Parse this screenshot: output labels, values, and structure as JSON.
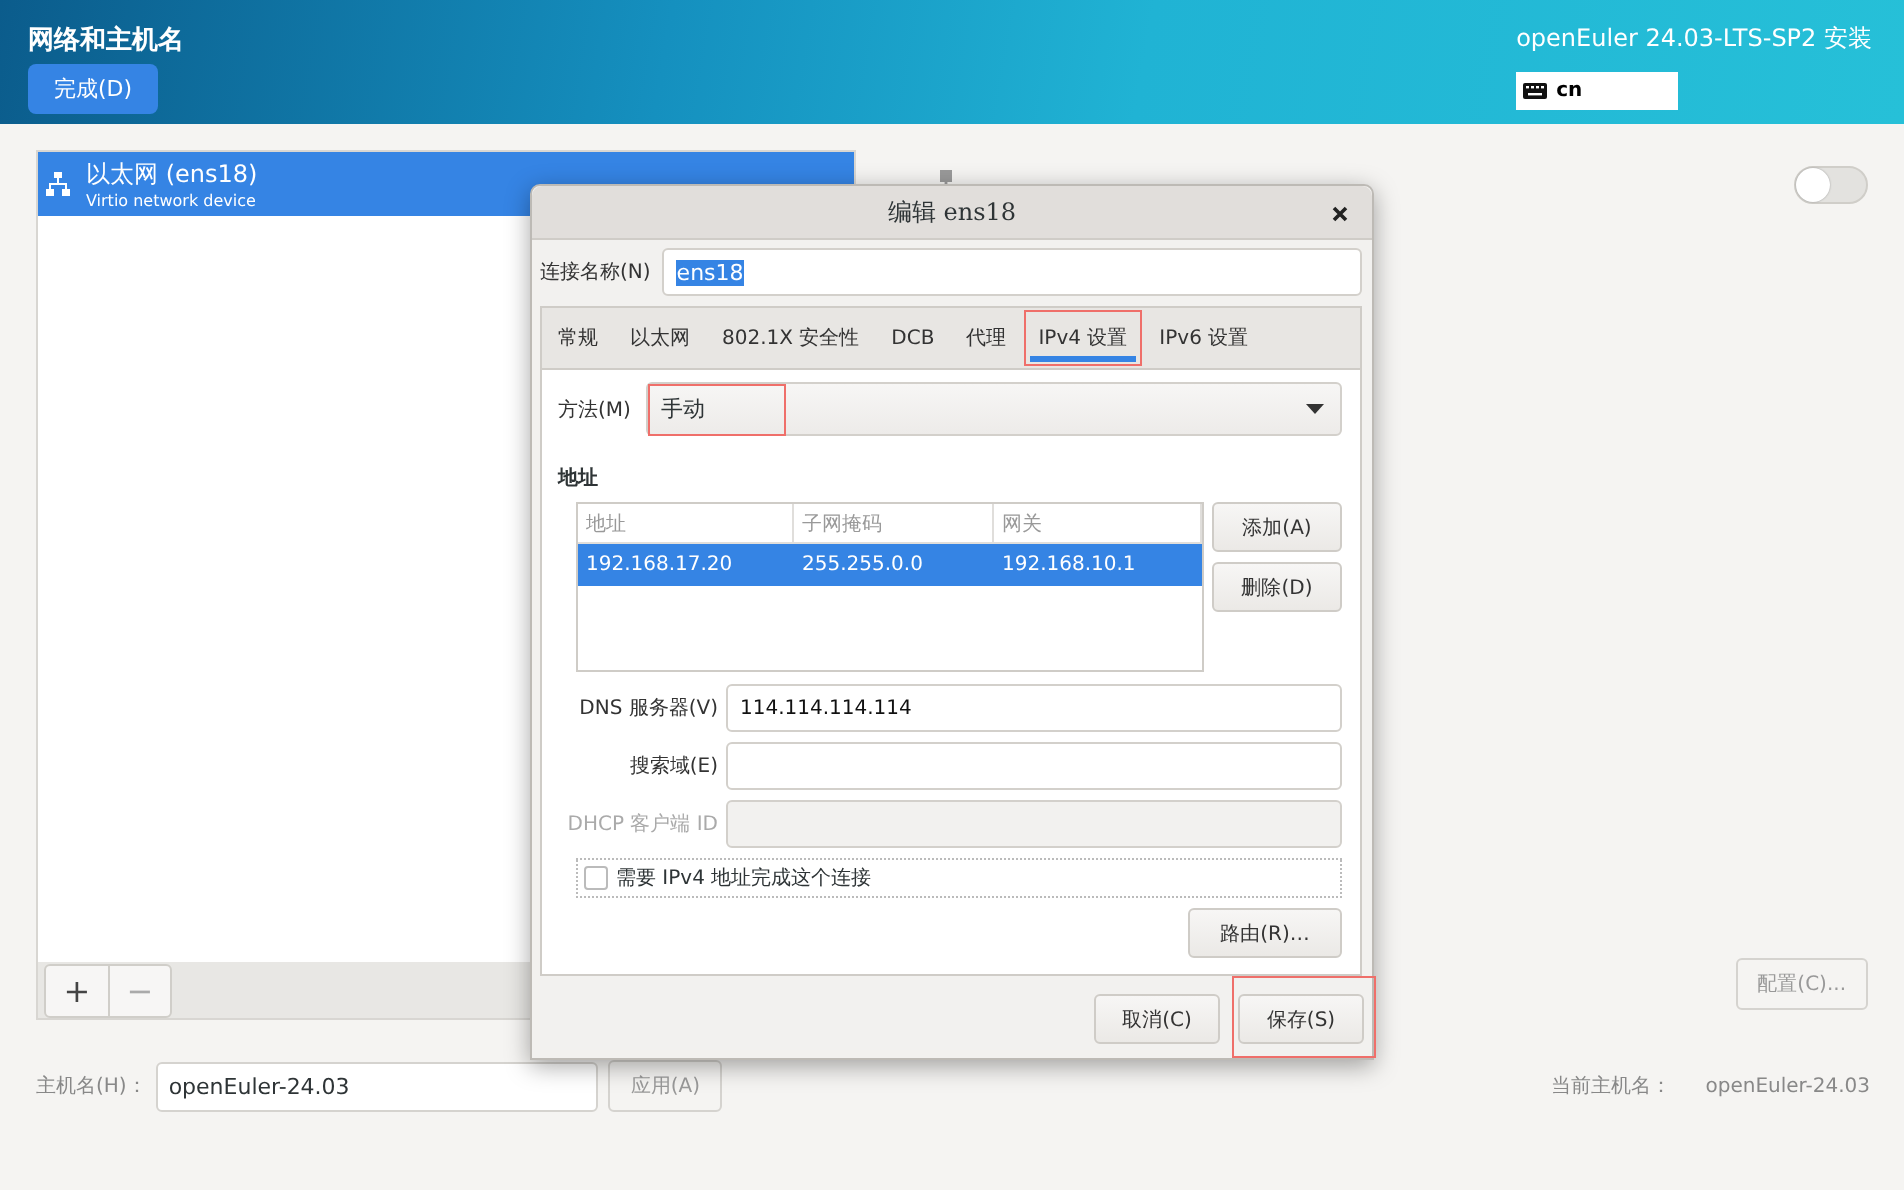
{
  "header": {
    "title": "网络和主机名",
    "done_button": "完成(D)",
    "product": "openEuler 24.03-LTS-SP2 安装",
    "keyboard_layout": "cn"
  },
  "devices": [
    {
      "name": "以太网 (ens18)",
      "description": "Virtio network device",
      "selected": true
    }
  ],
  "device_toolbar": {
    "add": "+",
    "remove": "−"
  },
  "device_switch": {
    "on": false
  },
  "configure_button": "配置(C)...",
  "hostname": {
    "label": "主机名(H)：",
    "value": "openEuler-24.03",
    "apply_button": "应用(A)",
    "current_label": "当前主机名：",
    "current_value": "openEuler-24.03"
  },
  "dialog": {
    "title": "编辑 ens18",
    "name_label": "连接名称(N)",
    "name_value": "ens18",
    "name_value_selected": true,
    "tabs": [
      {
        "label": "常规",
        "selected": false,
        "highlighted": false
      },
      {
        "label": "以太网",
        "selected": false,
        "highlighted": false
      },
      {
        "label": "802.1X 安全性",
        "selected": false,
        "highlighted": false
      },
      {
        "label": "DCB",
        "selected": false,
        "highlighted": false
      },
      {
        "label": "代理",
        "selected": false,
        "highlighted": false
      },
      {
        "label": "IPv4 设置",
        "selected": true,
        "highlighted": true
      },
      {
        "label": "IPv6 设置",
        "selected": false,
        "highlighted": false
      }
    ],
    "method": {
      "label": "方法(M)",
      "value": "手动",
      "highlighted": true
    },
    "address_heading": "地址",
    "address_table": {
      "columns": [
        "地址",
        "子网掩码",
        "网关"
      ],
      "rows": [
        {
          "cells": [
            "192.168.17.20",
            "255.255.0.0",
            "192.168.10.1"
          ],
          "selected": true
        }
      ]
    },
    "add_button": "添加(A)",
    "delete_button": "删除(D)",
    "fields": [
      {
        "label": "DNS 服务器(V)",
        "value": "114.114.114.114",
        "disabled": false
      },
      {
        "label": "搜索域(E)",
        "disabled": false
      },
      {
        "label": "DHCP 客户端 ID",
        "disabled": true
      }
    ],
    "require_ipv4": {
      "label": "需要 IPv4 地址完成这个连接",
      "checked": false
    },
    "routes_button": "路由(R)…",
    "buttons": [
      {
        "label": "取消(C)",
        "highlighted": false
      },
      {
        "label": "保存(S)",
        "highlighted": true
      }
    ]
  }
}
